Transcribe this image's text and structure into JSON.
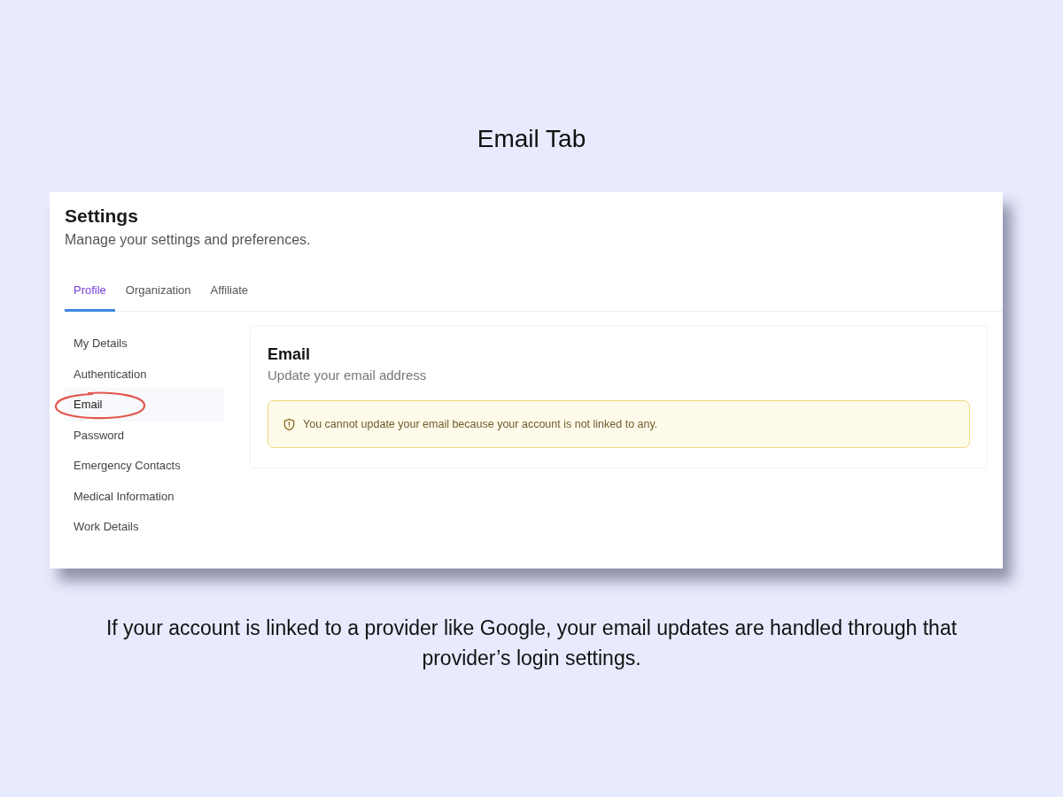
{
  "slide_title": "Email Tab",
  "settings": {
    "title": "Settings",
    "subtitle": "Manage your settings and preferences.",
    "tabs": [
      {
        "label": "Profile",
        "selected": true
      },
      {
        "label": "Organization",
        "selected": false
      },
      {
        "label": "Affiliate",
        "selected": false
      }
    ],
    "sidebar": {
      "items": [
        {
          "label": "My Details",
          "selected": false
        },
        {
          "label": "Authentication",
          "selected": false
        },
        {
          "label": "Email",
          "selected": true
        },
        {
          "label": "Password",
          "selected": false
        },
        {
          "label": "Emergency Contacts",
          "selected": false
        },
        {
          "label": "Medical Information",
          "selected": false
        },
        {
          "label": "Work Details",
          "selected": false
        }
      ]
    },
    "panel": {
      "title": "Email",
      "subtitle": "Update your email address",
      "alert": "You cannot update your email because your account is not linked to any."
    }
  },
  "caption": "If your account is linked to a provider like Google, your email updates are handled through that provider’s login settings."
}
